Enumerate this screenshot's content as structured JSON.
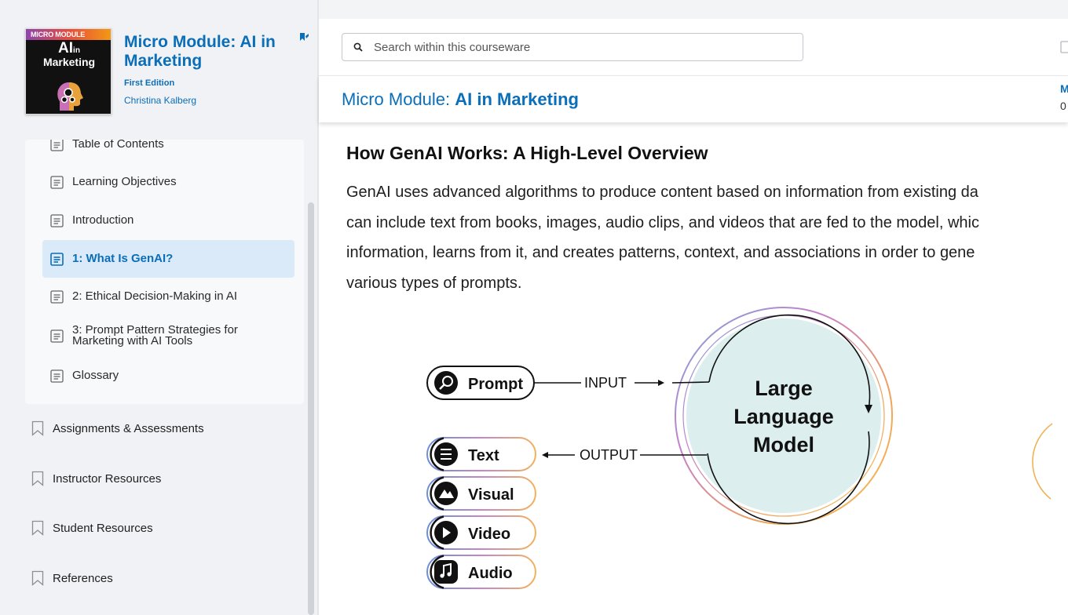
{
  "book": {
    "cover_band": "MICRO MODULE",
    "cover_ai": "AI",
    "cover_in": "in",
    "cover_marketing": "Marketing",
    "title": "Micro Module: AI in Marketing",
    "edition": "First Edition",
    "author": "Christina Kalberg"
  },
  "toc": {
    "items": [
      {
        "label": "Table of Contents"
      },
      {
        "label": "Learning Objectives"
      },
      {
        "label": "Introduction"
      },
      {
        "label": "1: What Is GenAI?"
      },
      {
        "label": "2: Ethical Decision-Making in AI"
      },
      {
        "label": "3: Prompt Pattern Strategies for Marketing with AI Tools"
      },
      {
        "label": "Glossary"
      }
    ],
    "active_index": 3
  },
  "side_links": [
    {
      "label": "Assignments & Assessments"
    },
    {
      "label": "Instructor Resources"
    },
    {
      "label": "Student Resources"
    },
    {
      "label": "References"
    }
  ],
  "search": {
    "placeholder": "Search within this courseware"
  },
  "module": {
    "title_prefix": "Micro Module: ",
    "title_bold": "AI in Marketing",
    "right_cut_1": "M",
    "right_cut_2": "0"
  },
  "section": {
    "heading": "How GenAI Works: A High-Level Overview",
    "lines": [
      "GenAI uses advanced algorithms to produce content based on information from existing da",
      "can include text from books, images, audio clips, and videos that are fed to the model, whic",
      "information, learns from it, and creates patterns, context, and associations in order to gene",
      "various types of prompts."
    ]
  },
  "diagram": {
    "prompt_label": "Prompt",
    "input_label": "INPUT",
    "output_label": "OUTPUT",
    "model_line1": "Large",
    "model_line2": "Language",
    "model_line3": "Model",
    "outputs": [
      "Text",
      "Visual",
      "Video",
      "Audio"
    ]
  },
  "colors": {
    "accent": "#0b6eb8",
    "active_bg": "#dbeaf8",
    "model_fill": "#dceeee"
  }
}
